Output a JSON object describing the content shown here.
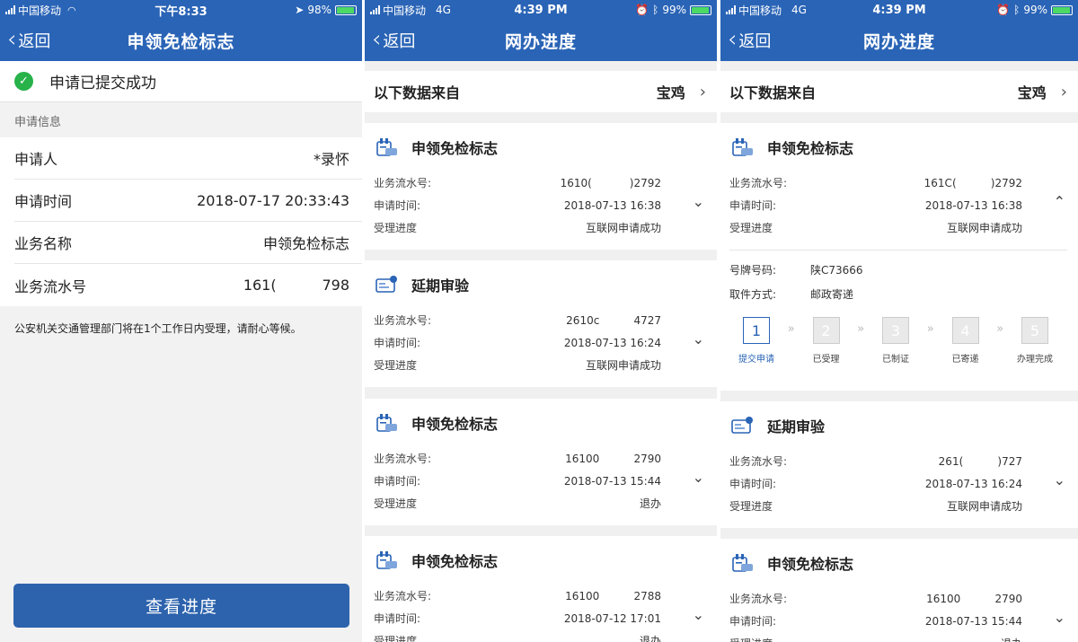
{
  "screen1": {
    "status": {
      "carrier": "中国移动",
      "time": "下午8:33",
      "battery": "98%"
    },
    "nav": {
      "back": "返回",
      "title": "申领免检标志"
    },
    "success_text": "申请已提交成功",
    "section_title": "申请信息",
    "info_rows": [
      {
        "label": "申请人",
        "value": "*录怀"
      },
      {
        "label": "申请时间",
        "value": "2018-07-17 20:33:43"
      },
      {
        "label": "业务名称",
        "value": "申领免检标志"
      },
      {
        "label": "业务流水号",
        "value": "161(          798"
      }
    ],
    "notice": "公安机关交通管理部门将在1个工作日内受理，请耐心等候。",
    "button": "查看进度"
  },
  "screen2": {
    "status": {
      "carrier": "中国移动",
      "network": "4G",
      "time": "4:39 PM",
      "battery": "99%"
    },
    "nav": {
      "back": "返回",
      "title": "网办进度"
    },
    "source_label": "以下数据来自",
    "source_city": "宝鸡",
    "cards": [
      {
        "title": "申领免检标志",
        "icon": "license-sticker-icon",
        "serial": "1610(           )2792",
        "time": "2018-07-13 16:38",
        "progress": "互联网申请成功"
      },
      {
        "title": "延期审验",
        "icon": "id-card-icon",
        "serial": "2610c          4727",
        "time": "2018-07-13 16:24",
        "progress": "互联网申请成功"
      },
      {
        "title": "申领免检标志",
        "icon": "license-sticker-icon",
        "serial": "16100          2790",
        "time": "2018-07-13 15:44",
        "progress": "退办"
      },
      {
        "title": "申领免检标志",
        "icon": "license-sticker-icon",
        "serial": "16100          2788",
        "time": "2018-07-12 17:01",
        "progress": "退办"
      }
    ],
    "labels": {
      "serial": "业务流水号:",
      "time": "申请时间:",
      "progress": "受理进度"
    }
  },
  "screen3": {
    "status": {
      "carrier": "中国移动",
      "network": "4G",
      "time": "4:39 PM",
      "battery": "99%"
    },
    "nav": {
      "back": "返回",
      "title": "网办进度"
    },
    "source_label": "以下数据来自",
    "source_city": "宝鸡",
    "expanded": {
      "title": "申领免检标志",
      "serial": "161C(          )2792",
      "time": "2018-07-13 16:38",
      "progress": "互联网申请成功",
      "plate_label": "号牌号码:",
      "plate": "陕C73666",
      "pickup_label": "取件方式:",
      "pickup": "邮政寄递",
      "steps": [
        {
          "n": "1",
          "label": "提交申请"
        },
        {
          "n": "2",
          "label": "已受理"
        },
        {
          "n": "3",
          "label": "已制证"
        },
        {
          "n": "4",
          "label": "已寄递"
        },
        {
          "n": "5",
          "label": "办理完成"
        }
      ]
    },
    "cards": [
      {
        "title": "延期审验",
        "serial": "261(          )727",
        "time": "2018-07-13 16:24",
        "progress": "互联网申请成功"
      },
      {
        "title": "申领免检标志",
        "serial": "16100          2790",
        "time": "2018-07-13 15:44",
        "progress": "退办"
      }
    ],
    "labels": {
      "serial": "业务流水号:",
      "time": "申请时间:",
      "progress": "受理进度"
    }
  },
  "colors": {
    "primary": "#2a64b6",
    "success": "#27b24a",
    "button": "#2d63ad"
  }
}
